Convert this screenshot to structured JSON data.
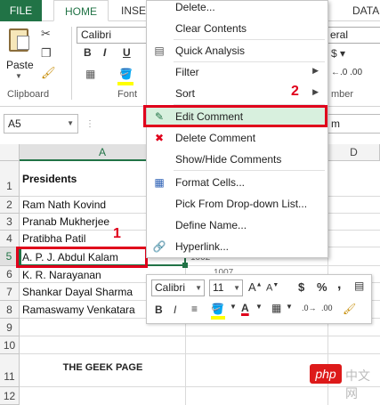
{
  "ribbon_tabs": {
    "file": "FILE",
    "home": "HOME",
    "insert": "INSE",
    "data": "DATA"
  },
  "ribbon": {
    "paste_label": "Paste",
    "clipboard_label": "Clipboard",
    "font_group_label": "Font",
    "number_group_label": "mber",
    "font_name": "Calibri",
    "right_format_box": "eral",
    "bold": "B",
    "italic": "I",
    "underline": "U",
    "right_txt_1": "$ ▾",
    "right_txt_2": "←.0 .00"
  },
  "namebox": {
    "value": "A5"
  },
  "formula_bar": {
    "right_text": "m"
  },
  "columns": [
    "A",
    "D"
  ],
  "rows": [
    "1",
    "2",
    "3",
    "4",
    "5",
    "6",
    "7",
    "8",
    "9",
    "10",
    "11",
    "12"
  ],
  "cells": {
    "header": "Presidents",
    "r2": "Ram Nath Kovind",
    "r3": "Pranab Mukherjee",
    "r4": "Pratibha Patil",
    "r5": "A. P. J. Abdul Kalam",
    "r6": "K. R. Narayanan",
    "r7": "Shankar Dayal Sharma",
    "r8": "Ramaswamy Venkatara",
    "footer": "THE GEEK PAGE",
    "partial_b5": "1002",
    "partial_b6": "1007"
  },
  "callouts": {
    "one": "1",
    "two": "2"
  },
  "context_menu": {
    "items": [
      {
        "label": "Delete...",
        "icon": "none"
      },
      {
        "label": "Clear Contents",
        "icon": "none"
      },
      {
        "label": "Quick Analysis",
        "icon": "quick-analysis-icon"
      },
      {
        "label": "Filter",
        "icon": "none"
      },
      {
        "label": "Sort",
        "icon": "none"
      },
      {
        "label": "Edit Comment",
        "icon": "edit-comment-icon"
      },
      {
        "label": "Delete Comment",
        "icon": "delete-comment-icon"
      },
      {
        "label": "Show/Hide Comments",
        "icon": "none"
      },
      {
        "label": "Format Cells...",
        "icon": "format-cells-icon"
      },
      {
        "label": "Pick From Drop-down List...",
        "icon": "none"
      },
      {
        "label": "Define Name...",
        "icon": "none"
      },
      {
        "label": "Hyperlink...",
        "icon": "hyperlink-icon"
      }
    ],
    "highlighted": "Edit Comment"
  },
  "mini_toolbar": {
    "font": "Calibri",
    "size": "11",
    "grow": "A",
    "shrink": "A",
    "currency": "$",
    "percent": "%",
    "comma": ",",
    "bold": "B",
    "italic": "I",
    "font_color_letter": "A"
  },
  "watermark": {
    "badge": "php",
    "text": "中文网"
  },
  "colors": {
    "excel_green": "#217346",
    "callout_red": "#e0001b",
    "menu_highlight": "#d8f0de"
  }
}
